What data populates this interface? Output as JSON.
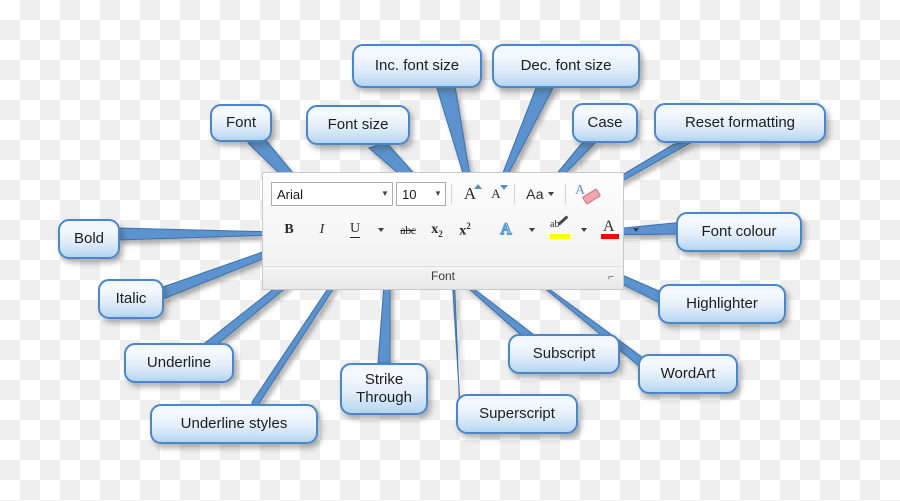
{
  "figure": {
    "title": "Word Font group annotated diagram",
    "background": "transparency-checkerboard",
    "accent_color": "#4a86c8",
    "connector_color": "#4e8ccc"
  },
  "ribbon": {
    "group_label": "Font",
    "dialog_launcher": "⌐",
    "font_name": {
      "value": "Arial",
      "caret": "▼"
    },
    "font_size": {
      "value": "10",
      "caret": "▼"
    },
    "buttons_row1": [
      {
        "name": "grow-font",
        "glyph": "A"
      },
      {
        "name": "shrink-font",
        "glyph": "A"
      },
      {
        "name": "change-case",
        "glyph": "Aa",
        "caret": "▼"
      },
      {
        "name": "clear-formatting",
        "glyph": "A"
      }
    ],
    "buttons_row2": [
      {
        "name": "bold",
        "glyph": "B"
      },
      {
        "name": "italic",
        "glyph": "I"
      },
      {
        "name": "underline",
        "glyph": "U",
        "caret": "▼"
      },
      {
        "name": "strikethrough",
        "glyph": "abc"
      },
      {
        "name": "subscript",
        "glyph": "x",
        "script": "2"
      },
      {
        "name": "superscript",
        "glyph": "x",
        "script": "2"
      },
      {
        "name": "text-effects",
        "glyph": "A",
        "caret": "▼"
      },
      {
        "name": "text-highlight",
        "glyph": "ab",
        "caret": "▼"
      },
      {
        "name": "font-color",
        "glyph": "A",
        "caret": "▼"
      }
    ]
  },
  "callouts": [
    {
      "id": "font",
      "label": "Font"
    },
    {
      "id": "font-size",
      "label": "Font size"
    },
    {
      "id": "inc-font-size",
      "label": "Inc. font size"
    },
    {
      "id": "dec-font-size",
      "label": "Dec. font size"
    },
    {
      "id": "case",
      "label": "Case"
    },
    {
      "id": "reset-formatting",
      "label": "Reset formatting"
    },
    {
      "id": "bold",
      "label": "Bold"
    },
    {
      "id": "italic",
      "label": "Italic"
    },
    {
      "id": "underline",
      "label": "Underline"
    },
    {
      "id": "underline-styles",
      "label": "Underline styles"
    },
    {
      "id": "strike-through",
      "label": "Strike\nThrough"
    },
    {
      "id": "superscript",
      "label": "Superscript"
    },
    {
      "id": "subscript",
      "label": "Subscript"
    },
    {
      "id": "wordart",
      "label": "WordArt"
    },
    {
      "id": "highlighter",
      "label": "Highlighter"
    },
    {
      "id": "font-colour",
      "label": "Font colour"
    }
  ]
}
